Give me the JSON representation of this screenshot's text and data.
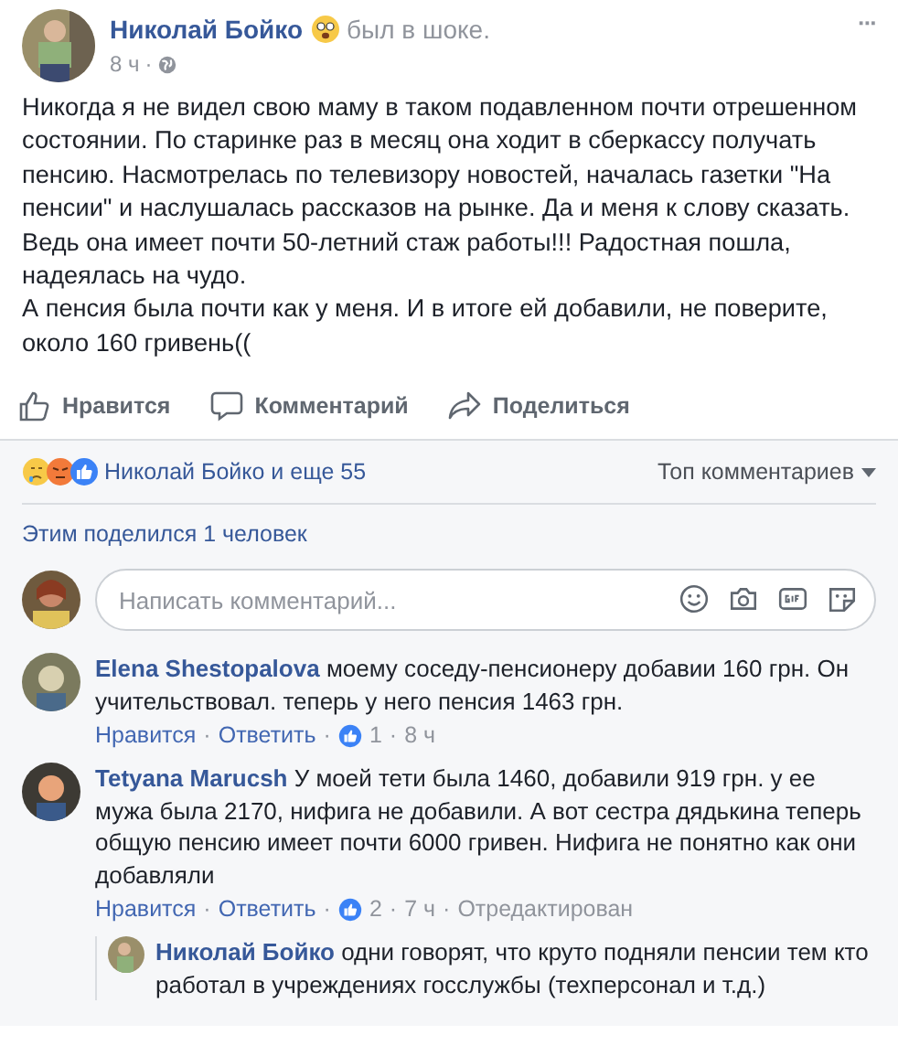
{
  "post": {
    "author": "Николай Бойко",
    "feeling": "был в шоке.",
    "time": "8 ч",
    "separator": "·",
    "more": "···",
    "paragraphs": [
      "Никогда я не видел свою маму в таком подавленном почти отрешенном состоянии. По старинке раз в месяц она ходит в сберкассу получать пенсию. Насмотрелась по телевизору новостей, началась газетки \"На пенсии\" и наслушалась рассказов на рынке. Да и меня к слову сказать. Ведь она имеет почти 50-летний стаж работы!!! Радостная пошла, надеялась на чудо.",
      "А пенсия была почти как у меня. И в итоге ей добавили, не поверите, около 160 гривень(("
    ]
  },
  "actions": [
    {
      "kind": "like",
      "label": "Нравится"
    },
    {
      "kind": "comment",
      "label": "Комментарий"
    },
    {
      "kind": "share",
      "label": "Поделиться"
    }
  ],
  "reactions": {
    "summary": "Николай Бойко и еще 55",
    "sort": "Топ комментариев"
  },
  "shares": "Этим поделился 1 человек",
  "comment_box": {
    "placeholder": "Написать комментарий..."
  },
  "comments": [
    {
      "author": "Elena Shestopalova",
      "text": "моему соседу-пенсионеру добавии 160 грн. Он учительствовал. теперь у него пенсия 1463 грн.",
      "like": "Нравится",
      "reply": "Ответить",
      "likes": "1",
      "time": "8 ч"
    },
    {
      "author": "Tetyana Marucsh",
      "text": "У моей тети была 1460, добавили 919 грн. у ее мужа была 2170, нифига не добавили. А вот сестра дядькина теперь общую пенсию имеет почти 6000 гривен. Нифига не понятно как они добавляли",
      "like": "Нравится",
      "reply": "Ответить",
      "likes": "2",
      "time": "7 ч",
      "edited": "Отредактирован",
      "replies": [
        {
          "author": "Николай Бойко",
          "text": "одни говорят, что круто подняли пенсии тем кто работал в учреждениях госслужбы (техперсонал и т.д.)"
        }
      ]
    }
  ]
}
